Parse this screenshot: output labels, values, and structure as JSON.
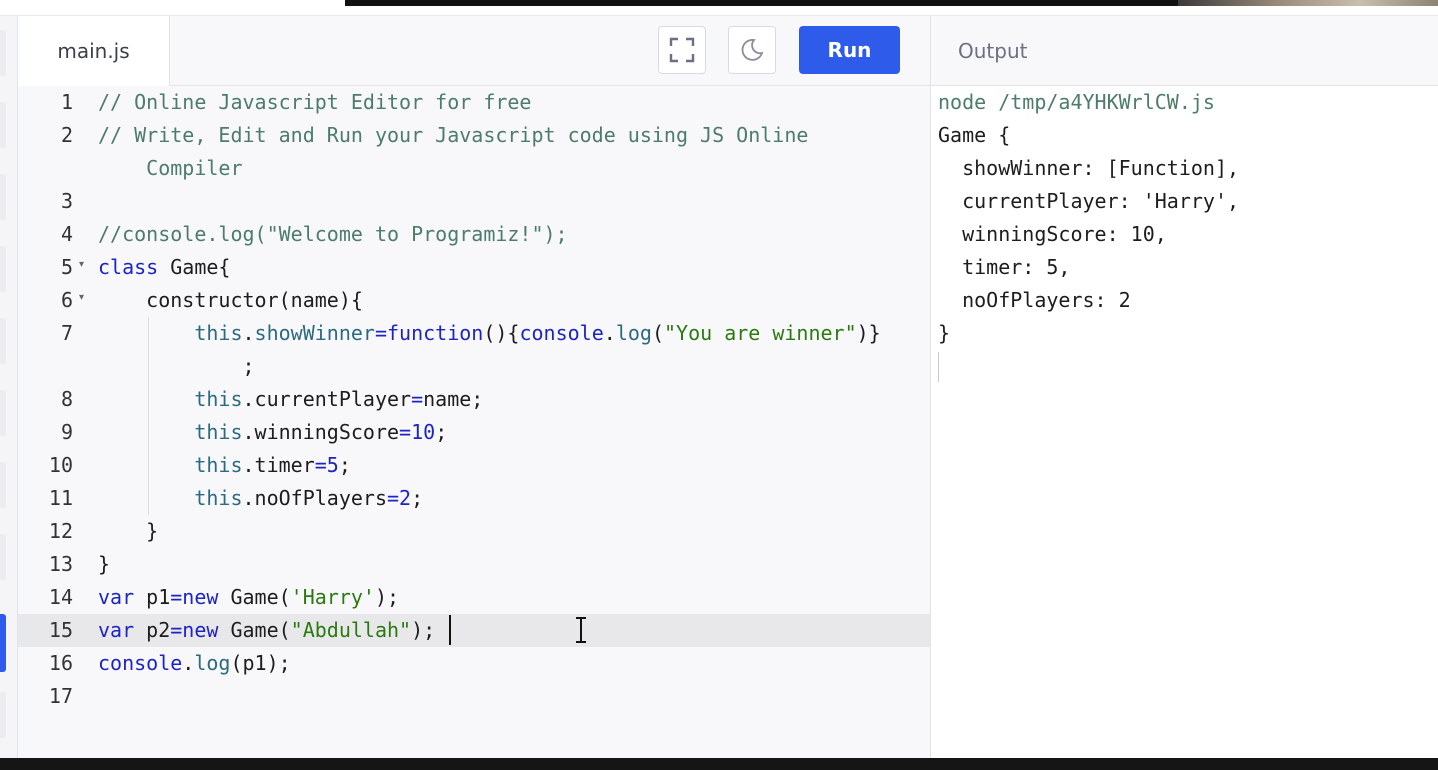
{
  "editor_tab": {
    "label": "main.js"
  },
  "toolbar": {
    "fullscreen_icon": "fullscreen-icon",
    "theme_icon": "moon-icon",
    "run_label": "Run"
  },
  "output_tab": {
    "label": "Output"
  },
  "editor": {
    "active_line": 15,
    "lines": [
      {
        "no": "1",
        "segments": [
          {
            "t": "// Online Javascript Editor for free",
            "c": "cmt"
          }
        ]
      },
      {
        "no": "2",
        "segments": [
          {
            "t": "// Write, Edit and Run your Javascript code using JS Online",
            "c": "cmt"
          }
        ]
      },
      {
        "no": "",
        "segments": [
          {
            "t": "    Compiler",
            "c": "cmt"
          }
        ]
      },
      {
        "no": "3",
        "segments": []
      },
      {
        "no": "4",
        "segments": [
          {
            "t": "//console.log(\"Welcome to Programiz!\");",
            "c": "cmt"
          }
        ]
      },
      {
        "no": "5",
        "fold": true,
        "segments": [
          {
            "t": "class",
            "c": "kw"
          },
          {
            "t": " Game{",
            "c": ""
          }
        ]
      },
      {
        "no": "6",
        "fold": true,
        "segments": [
          {
            "t": "    constructor(name){",
            "c": ""
          }
        ]
      },
      {
        "no": "7",
        "segments": [
          {
            "t": "        ",
            "c": ""
          },
          {
            "t": "this",
            "c": "this"
          },
          {
            "t": ".",
            "c": ""
          },
          {
            "t": "showWinner",
            "c": "this"
          },
          {
            "t": "=",
            "c": "op"
          },
          {
            "t": "function",
            "c": "kw"
          },
          {
            "t": "(){",
            "c": ""
          },
          {
            "t": "console",
            "c": "kw"
          },
          {
            "t": ".",
            "c": ""
          },
          {
            "t": "log",
            "c": "fn"
          },
          {
            "t": "(",
            "c": ""
          },
          {
            "t": "\"You are winner\"",
            "c": "str"
          },
          {
            "t": ")}",
            "c": ""
          }
        ]
      },
      {
        "no": "",
        "segments": [
          {
            "t": "            ;",
            "c": ""
          }
        ]
      },
      {
        "no": "8",
        "segments": [
          {
            "t": "        ",
            "c": ""
          },
          {
            "t": "this",
            "c": "this"
          },
          {
            "t": ".currentPlayer",
            "c": ""
          },
          {
            "t": "=",
            "c": "op"
          },
          {
            "t": "name;",
            "c": ""
          }
        ]
      },
      {
        "no": "9",
        "segments": [
          {
            "t": "        ",
            "c": ""
          },
          {
            "t": "this",
            "c": "this"
          },
          {
            "t": ".winningScore",
            "c": ""
          },
          {
            "t": "=",
            "c": "op"
          },
          {
            "t": "10",
            "c": "num"
          },
          {
            "t": ";",
            "c": ""
          }
        ]
      },
      {
        "no": "10",
        "segments": [
          {
            "t": "        ",
            "c": ""
          },
          {
            "t": "this",
            "c": "this"
          },
          {
            "t": ".timer",
            "c": ""
          },
          {
            "t": "=",
            "c": "op"
          },
          {
            "t": "5",
            "c": "num"
          },
          {
            "t": ";",
            "c": ""
          }
        ]
      },
      {
        "no": "11",
        "segments": [
          {
            "t": "        ",
            "c": ""
          },
          {
            "t": "this",
            "c": "this"
          },
          {
            "t": ".noOfPlayers",
            "c": ""
          },
          {
            "t": "=",
            "c": "op"
          },
          {
            "t": "2",
            "c": "num"
          },
          {
            "t": ";",
            "c": ""
          }
        ]
      },
      {
        "no": "12",
        "segments": [
          {
            "t": "    }",
            "c": ""
          }
        ]
      },
      {
        "no": "13",
        "segments": [
          {
            "t": "}",
            "c": ""
          }
        ]
      },
      {
        "no": "14",
        "segments": [
          {
            "t": "var",
            "c": "kw"
          },
          {
            "t": " p1",
            "c": ""
          },
          {
            "t": "=",
            "c": "op"
          },
          {
            "t": "new",
            "c": "kw"
          },
          {
            "t": " Game(",
            "c": ""
          },
          {
            "t": "'Harry'",
            "c": "str"
          },
          {
            "t": ");",
            "c": ""
          }
        ]
      },
      {
        "no": "15",
        "segments": [
          {
            "t": "var",
            "c": "kw"
          },
          {
            "t": " p2",
            "c": ""
          },
          {
            "t": "=",
            "c": "op"
          },
          {
            "t": "new",
            "c": "kw"
          },
          {
            "t": " Game(",
            "c": ""
          },
          {
            "t": "\"Abdullah\"",
            "c": "str"
          },
          {
            "t": ");",
            "c": ""
          }
        ]
      },
      {
        "no": "16",
        "segments": [
          {
            "t": "console",
            "c": "kw"
          },
          {
            "t": ".",
            "c": ""
          },
          {
            "t": "log",
            "c": "fn"
          },
          {
            "t": "(p1);",
            "c": ""
          }
        ]
      },
      {
        "no": "17",
        "segments": []
      }
    ]
  },
  "output": {
    "lines": [
      {
        "t": "node /tmp/a4YHKWrlCW.js",
        "cmd": true
      },
      {
        "t": "Game {"
      },
      {
        "t": "  showWinner: [Function],"
      },
      {
        "t": "  currentPlayer: 'Harry',"
      },
      {
        "t": "  winningScore: 10,"
      },
      {
        "t": "  timer: 5,"
      },
      {
        "t": "  noOfPlayers: 2"
      },
      {
        "t": "}"
      }
    ]
  }
}
